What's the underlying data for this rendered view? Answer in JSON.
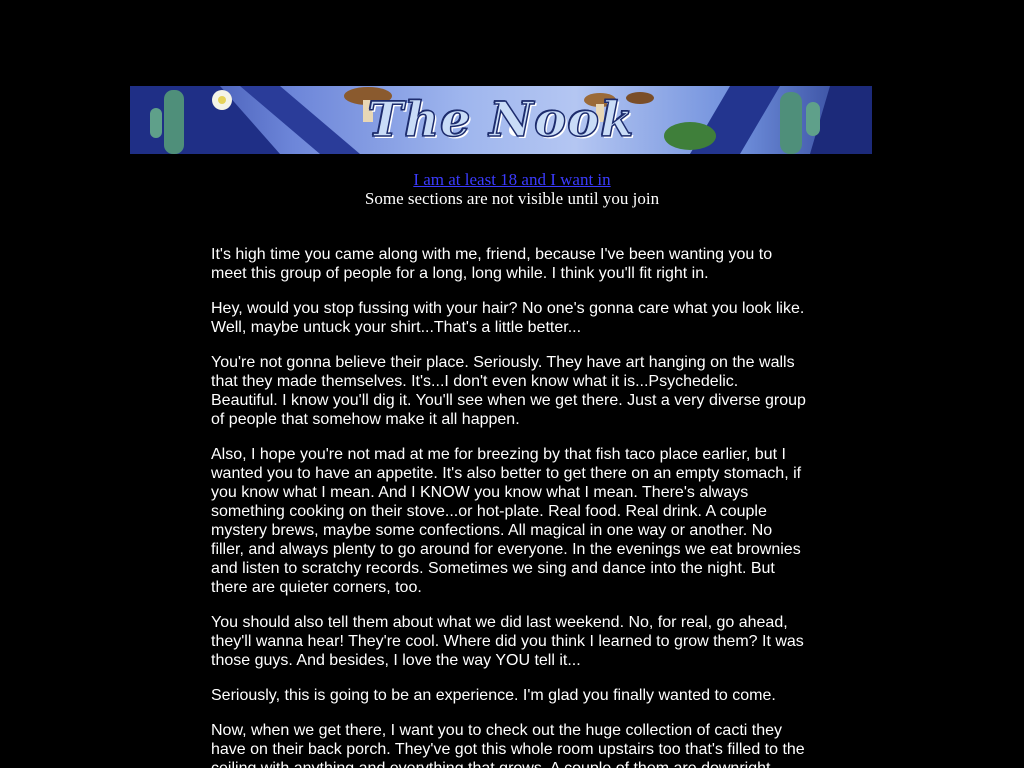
{
  "banner": {
    "title": "The Nook",
    "colors": {
      "sky": "#9fb6ee",
      "cactus": "#4f8f7a",
      "mushroom": "#8a5a2e"
    }
  },
  "enter": {
    "link_label": "I am at least 18 and I want in",
    "note": "Some sections are not visible until you join",
    "link_color": "#3b3bff"
  },
  "story": {
    "paragraphs": [
      "It's high time you came along with me, friend, because I've been wanting you to meet this group of people for a long, long while. I think you'll fit right in.",
      "Hey, would you stop fussing with your hair? No one's gonna care what you look like. Well, maybe untuck your shirt...That's a little better...",
      "You're not gonna believe their place. Seriously. They have art hanging on the walls that they made themselves. It's...I don't even know what it is...Psychedelic. Beautiful. I know you'll dig it. You'll see when we get there. Just a very diverse group of people that somehow make it all happen.",
      "Also, I hope you're not mad at me for breezing by that fish taco place earlier, but I wanted you to have an appetite. It's also better to get there on an empty stomach, if you know what I mean. And I KNOW you know what I mean. There's always something cooking on their stove...or hot-plate. Real food. Real drink. A couple mystery brews, maybe some confections. All magical in one way or another. No filler, and always plenty to go around for everyone. In the evenings we eat brownies and listen to scratchy records. Sometimes we sing and dance into the night. But there are quieter corners, too.",
      "You should also tell them about what we did last weekend. No, for real, go ahead, they'll wanna hear! They're cool. Where did you think I learned to grow them? It was those guys. And besides, I love the way YOU tell it...",
      "Seriously, this is going to be an experience. I'm glad you finally wanted to come.",
      "Now, when we get there, I want you to check out the huge collection of cacti they have on their back porch. They've got this whole room upstairs too that's filled to the ceiling with anything and everything that grows. A couple of them are downright"
    ]
  }
}
